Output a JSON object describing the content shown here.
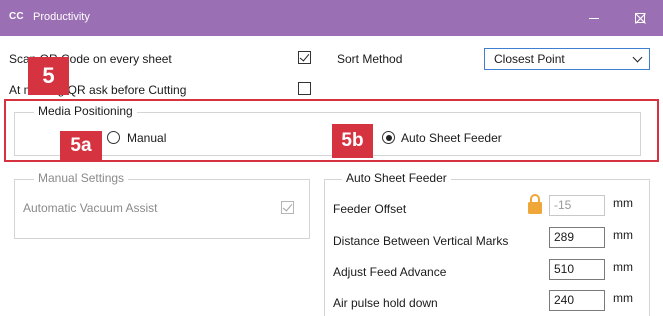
{
  "window": {
    "logo": "CC",
    "title": "Productivity"
  },
  "settings": {
    "qr_code_label": "Scan QR Code on every sheet",
    "qr_code_checked": true,
    "missing_qr_label": "At missing QR ask before Cutting",
    "missing_qr_checked": false,
    "sort_method_label": "Sort Method",
    "sort_method_value": "Closest Point"
  },
  "media_positioning": {
    "title": "Media Positioning",
    "manual_label": "Manual",
    "manual_selected": false,
    "auto_label": "Auto Sheet Feeder",
    "auto_selected": true
  },
  "callouts": {
    "main": "5",
    "a": "5a",
    "b": "5b"
  },
  "manual_settings": {
    "title": "Manual Settings",
    "vacuum_label": "Automatic Vacuum Assist",
    "vacuum_checked": true
  },
  "auto_sheet_feeder": {
    "title": "Auto Sheet Feeder",
    "rows": [
      {
        "label": "Feeder Offset",
        "value": "-15",
        "unit": "mm",
        "locked": true
      },
      {
        "label": "Distance Between Vertical Marks",
        "value": "289",
        "unit": "mm",
        "locked": false
      },
      {
        "label": "Adjust Feed Advance",
        "value": "510",
        "unit": "mm",
        "locked": false
      },
      {
        "label": "Air pulse hold down",
        "value": "240",
        "unit": "mm",
        "locked": false
      }
    ]
  },
  "colors": {
    "titlebar": "#9b6fb3",
    "highlight": "#d63340",
    "select_border": "#3f7fd0",
    "lock": "#f0a73a"
  },
  "icons": {
    "lock": "lock-icon",
    "minimize": "minimize-icon",
    "maximize": "maximize-icon",
    "close": "close-icon"
  }
}
